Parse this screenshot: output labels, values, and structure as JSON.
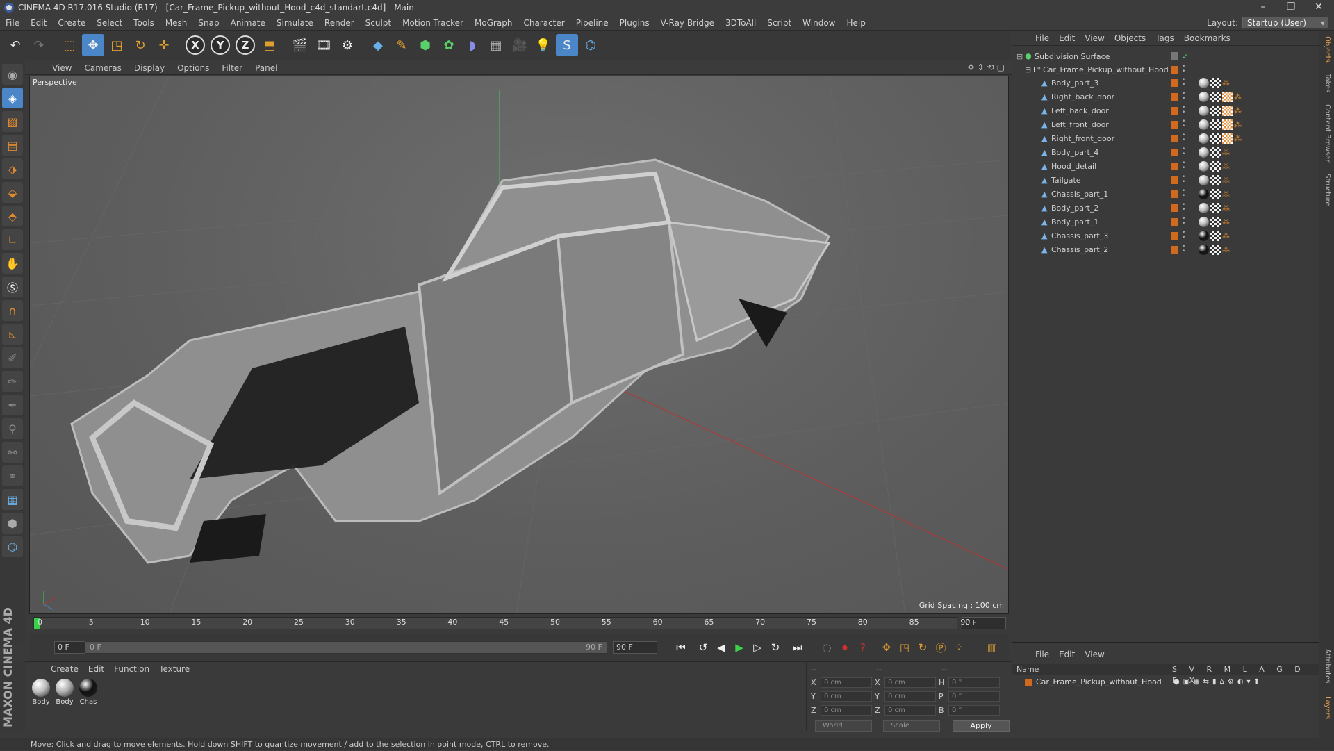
{
  "window": {
    "title": "CINEMA 4D R17.016 Studio (R17) - [Car_Frame_Pickup_without_Hood_c4d_standart.c4d] - Main",
    "minimize": "–",
    "restore": "❐",
    "close": "✕"
  },
  "menu": [
    "File",
    "Edit",
    "Create",
    "Select",
    "Tools",
    "Mesh",
    "Snap",
    "Animate",
    "Simulate",
    "Render",
    "Sculpt",
    "Motion Tracker",
    "MoGraph",
    "Character",
    "Pipeline",
    "Plugins",
    "V-Ray Bridge",
    "3DToAll",
    "Script",
    "Window",
    "Help"
  ],
  "layout": {
    "label": "Layout:",
    "value": "Startup (User)"
  },
  "viewport": {
    "menu": [
      "View",
      "Cameras",
      "Display",
      "Options",
      "Filter",
      "Panel"
    ],
    "label": "Perspective",
    "grid_spacing": "Grid Spacing : 100 cm"
  },
  "timeline": {
    "ticks": [
      "0",
      "5",
      "10",
      "15",
      "20",
      "25",
      "30",
      "35",
      "40",
      "45",
      "50",
      "55",
      "60",
      "65",
      "70",
      "75",
      "80",
      "85",
      "90"
    ],
    "current_frame": "0 F",
    "start_field": "0 F",
    "slider_start": "0 F",
    "slider_end": "90 F",
    "end_field": "90 F"
  },
  "material_panel": {
    "menu": [
      "Create",
      "Edit",
      "Function",
      "Texture"
    ],
    "materials": [
      {
        "label": "Body",
        "color": "#bdbdbd"
      },
      {
        "label": "Body",
        "color": "#b0b0b0"
      },
      {
        "label": "Chas",
        "color": "#111111"
      }
    ]
  },
  "brand": "MAXON CINEMA 4D",
  "coordinates": {
    "header": [
      "--",
      "--",
      "--"
    ],
    "rows": [
      {
        "a": "X",
        "av": "0 cm",
        "b": "X",
        "bv": "0 cm",
        "c": "H",
        "cv": "0 °"
      },
      {
        "a": "Y",
        "av": "0 cm",
        "b": "Y",
        "bv": "0 cm",
        "c": "P",
        "cv": "0 °"
      },
      {
        "a": "Z",
        "av": "0 cm",
        "b": "Z",
        "bv": "0 cm",
        "c": "B",
        "cv": "0 °"
      }
    ],
    "mode": "World",
    "scale": "Scale",
    "apply": "Apply"
  },
  "object_panel": {
    "menu": [
      "File",
      "Edit",
      "View",
      "Objects",
      "Tags",
      "Bookmarks"
    ],
    "root": "Subdivision Surface",
    "group": "Car_Frame_Pickup_without_Hood",
    "objects": [
      {
        "name": "Body_part_3",
        "tex": false,
        "mat": "#bdbdbd"
      },
      {
        "name": "Right_back_door",
        "tex": true,
        "mat": "#bdbdbd"
      },
      {
        "name": "Left_back_door",
        "tex": true,
        "mat": "#bdbdbd"
      },
      {
        "name": "Left_front_door",
        "tex": true,
        "mat": "#bdbdbd"
      },
      {
        "name": "Right_front_door",
        "tex": true,
        "mat": "#bdbdbd"
      },
      {
        "name": "Body_part_4",
        "tex": false,
        "mat": "#bdbdbd"
      },
      {
        "name": "Hood_detail",
        "tex": false,
        "mat": "#bdbdbd"
      },
      {
        "name": "Tailgate",
        "tex": false,
        "mat": "#bdbdbd"
      },
      {
        "name": "Chassis_part_1",
        "tex": false,
        "mat": "#111111"
      },
      {
        "name": "Body_part_2",
        "tex": false,
        "mat": "#bdbdbd"
      },
      {
        "name": "Body_part_1",
        "tex": false,
        "mat": "#bdbdbd"
      },
      {
        "name": "Chassis_part_3",
        "tex": false,
        "mat": "#111111"
      },
      {
        "name": "Chassis_part_2",
        "tex": false,
        "mat": "#111111"
      }
    ]
  },
  "layer_panel": {
    "menu": [
      "File",
      "Edit",
      "View"
    ],
    "col_name": "Name",
    "cols": "S V R M L A G D E X",
    "layer": "Car_Frame_Pickup_without_Hood"
  },
  "right_tabs": [
    "Objects",
    "Takes",
    "Content Browser",
    "Structure",
    "Attributes",
    "Layers"
  ],
  "status": "Move: Click and drag to move elements. Hold down SHIFT to quantize movement / add to the selection in point mode, CTRL to remove.",
  "colors": {
    "accent": "#d26a1e",
    "selection": "#4a86c8"
  }
}
